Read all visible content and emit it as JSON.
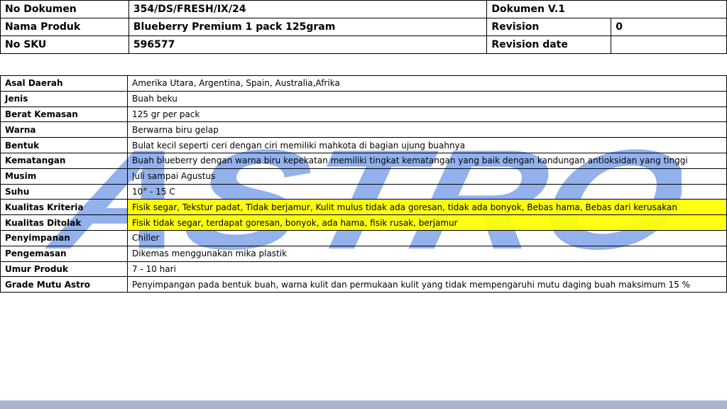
{
  "header": {
    "doc_number_label": "No Dokumen",
    "doc_number_value": "354/DS/FRESH/IX/24",
    "doc_version": "Dokumen V.1",
    "product_name_label": "Nama Produk",
    "product_name_value": "Blueberry Premium 1 pack 125gram",
    "revision_label": "Revision",
    "revision_value": "0",
    "sku_label": "No SKU",
    "sku_value": "596577",
    "revision_date_label": "Revision date",
    "revision_date_value": ""
  },
  "specs": [
    {
      "label": "Asal Daerah",
      "value": "Amerika Utara, Argentina, Spain,  Australia,Afrika"
    },
    {
      "label": "Jenis",
      "value": "Buah beku"
    },
    {
      "label": "Berat Kemasan",
      "value": "125 gr per pack"
    },
    {
      "label": "Warna",
      "value": "Berwarna biru gelap"
    },
    {
      "label": "Bentuk",
      "value": "Bulat kecil seperti ceri dengan ciri memiliki mahkota di bagian ujung buahnya"
    },
    {
      "label": "Kematangan",
      "value": "Buah blueberry dengan warna biru kepekatan memiliki tingkat kematangan yang baik dengan kandungan antioksidan yang tinggi"
    },
    {
      "label": "Musim",
      "value": "Juli sampai Agustus"
    },
    {
      "label": "Suhu",
      "value": "10° - 15 C"
    },
    {
      "label": "Kualitas Kriteria",
      "value": "Fisik segar, Tekstur padat, Tidak berjamur, Kulit mulus tidak ada goresan, tidak ada bonyok, Bebas hama, Bebas dari kerusakan"
    },
    {
      "label": "Kualitas Ditolak",
      "value": "Fisik tidak segar, terdapat goresan, bonyok, ada hama, fisik rusak, berjamur"
    },
    {
      "label": "Penyimpanan",
      "value": "Chiller"
    },
    {
      "label": "Pengemasan",
      "value": "Dikemas menggunakan mika plastik"
    },
    {
      "label": "Umur Produk",
      "value": "7 - 10 hari"
    },
    {
      "label": "Grade Mutu Astro",
      "value": "Penyimpangan pada bentuk buah, warna kulit dan permukaan kulit yang tidak mempengaruhi mutu daging buah maksimum 15 %"
    }
  ],
  "watermark": {
    "text": "ASTRO",
    "color": "#7fa3ea"
  },
  "colors": {
    "highlight": "#ffff00",
    "bottom_bar": "#a9b5cf"
  }
}
